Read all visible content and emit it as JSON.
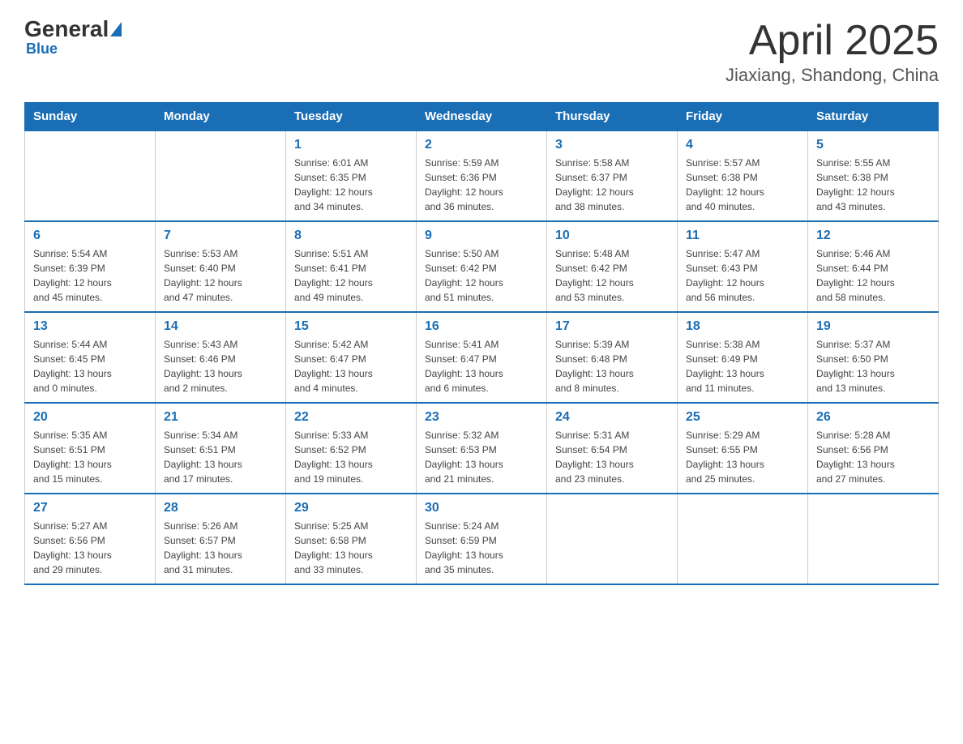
{
  "logo": {
    "general": "General",
    "blue": "Blue"
  },
  "header": {
    "month": "April 2025",
    "location": "Jiaxiang, Shandong, China"
  },
  "weekdays": [
    "Sunday",
    "Monday",
    "Tuesday",
    "Wednesday",
    "Thursday",
    "Friday",
    "Saturday"
  ],
  "weeks": [
    [
      {
        "day": "",
        "info": ""
      },
      {
        "day": "",
        "info": ""
      },
      {
        "day": "1",
        "info": "Sunrise: 6:01 AM\nSunset: 6:35 PM\nDaylight: 12 hours\nand 34 minutes."
      },
      {
        "day": "2",
        "info": "Sunrise: 5:59 AM\nSunset: 6:36 PM\nDaylight: 12 hours\nand 36 minutes."
      },
      {
        "day": "3",
        "info": "Sunrise: 5:58 AM\nSunset: 6:37 PM\nDaylight: 12 hours\nand 38 minutes."
      },
      {
        "day": "4",
        "info": "Sunrise: 5:57 AM\nSunset: 6:38 PM\nDaylight: 12 hours\nand 40 minutes."
      },
      {
        "day": "5",
        "info": "Sunrise: 5:55 AM\nSunset: 6:38 PM\nDaylight: 12 hours\nand 43 minutes."
      }
    ],
    [
      {
        "day": "6",
        "info": "Sunrise: 5:54 AM\nSunset: 6:39 PM\nDaylight: 12 hours\nand 45 minutes."
      },
      {
        "day": "7",
        "info": "Sunrise: 5:53 AM\nSunset: 6:40 PM\nDaylight: 12 hours\nand 47 minutes."
      },
      {
        "day": "8",
        "info": "Sunrise: 5:51 AM\nSunset: 6:41 PM\nDaylight: 12 hours\nand 49 minutes."
      },
      {
        "day": "9",
        "info": "Sunrise: 5:50 AM\nSunset: 6:42 PM\nDaylight: 12 hours\nand 51 minutes."
      },
      {
        "day": "10",
        "info": "Sunrise: 5:48 AM\nSunset: 6:42 PM\nDaylight: 12 hours\nand 53 minutes."
      },
      {
        "day": "11",
        "info": "Sunrise: 5:47 AM\nSunset: 6:43 PM\nDaylight: 12 hours\nand 56 minutes."
      },
      {
        "day": "12",
        "info": "Sunrise: 5:46 AM\nSunset: 6:44 PM\nDaylight: 12 hours\nand 58 minutes."
      }
    ],
    [
      {
        "day": "13",
        "info": "Sunrise: 5:44 AM\nSunset: 6:45 PM\nDaylight: 13 hours\nand 0 minutes."
      },
      {
        "day": "14",
        "info": "Sunrise: 5:43 AM\nSunset: 6:46 PM\nDaylight: 13 hours\nand 2 minutes."
      },
      {
        "day": "15",
        "info": "Sunrise: 5:42 AM\nSunset: 6:47 PM\nDaylight: 13 hours\nand 4 minutes."
      },
      {
        "day": "16",
        "info": "Sunrise: 5:41 AM\nSunset: 6:47 PM\nDaylight: 13 hours\nand 6 minutes."
      },
      {
        "day": "17",
        "info": "Sunrise: 5:39 AM\nSunset: 6:48 PM\nDaylight: 13 hours\nand 8 minutes."
      },
      {
        "day": "18",
        "info": "Sunrise: 5:38 AM\nSunset: 6:49 PM\nDaylight: 13 hours\nand 11 minutes."
      },
      {
        "day": "19",
        "info": "Sunrise: 5:37 AM\nSunset: 6:50 PM\nDaylight: 13 hours\nand 13 minutes."
      }
    ],
    [
      {
        "day": "20",
        "info": "Sunrise: 5:35 AM\nSunset: 6:51 PM\nDaylight: 13 hours\nand 15 minutes."
      },
      {
        "day": "21",
        "info": "Sunrise: 5:34 AM\nSunset: 6:51 PM\nDaylight: 13 hours\nand 17 minutes."
      },
      {
        "day": "22",
        "info": "Sunrise: 5:33 AM\nSunset: 6:52 PM\nDaylight: 13 hours\nand 19 minutes."
      },
      {
        "day": "23",
        "info": "Sunrise: 5:32 AM\nSunset: 6:53 PM\nDaylight: 13 hours\nand 21 minutes."
      },
      {
        "day": "24",
        "info": "Sunrise: 5:31 AM\nSunset: 6:54 PM\nDaylight: 13 hours\nand 23 minutes."
      },
      {
        "day": "25",
        "info": "Sunrise: 5:29 AM\nSunset: 6:55 PM\nDaylight: 13 hours\nand 25 minutes."
      },
      {
        "day": "26",
        "info": "Sunrise: 5:28 AM\nSunset: 6:56 PM\nDaylight: 13 hours\nand 27 minutes."
      }
    ],
    [
      {
        "day": "27",
        "info": "Sunrise: 5:27 AM\nSunset: 6:56 PM\nDaylight: 13 hours\nand 29 minutes."
      },
      {
        "day": "28",
        "info": "Sunrise: 5:26 AM\nSunset: 6:57 PM\nDaylight: 13 hours\nand 31 minutes."
      },
      {
        "day": "29",
        "info": "Sunrise: 5:25 AM\nSunset: 6:58 PM\nDaylight: 13 hours\nand 33 minutes."
      },
      {
        "day": "30",
        "info": "Sunrise: 5:24 AM\nSunset: 6:59 PM\nDaylight: 13 hours\nand 35 minutes."
      },
      {
        "day": "",
        "info": ""
      },
      {
        "day": "",
        "info": ""
      },
      {
        "day": "",
        "info": ""
      }
    ]
  ]
}
